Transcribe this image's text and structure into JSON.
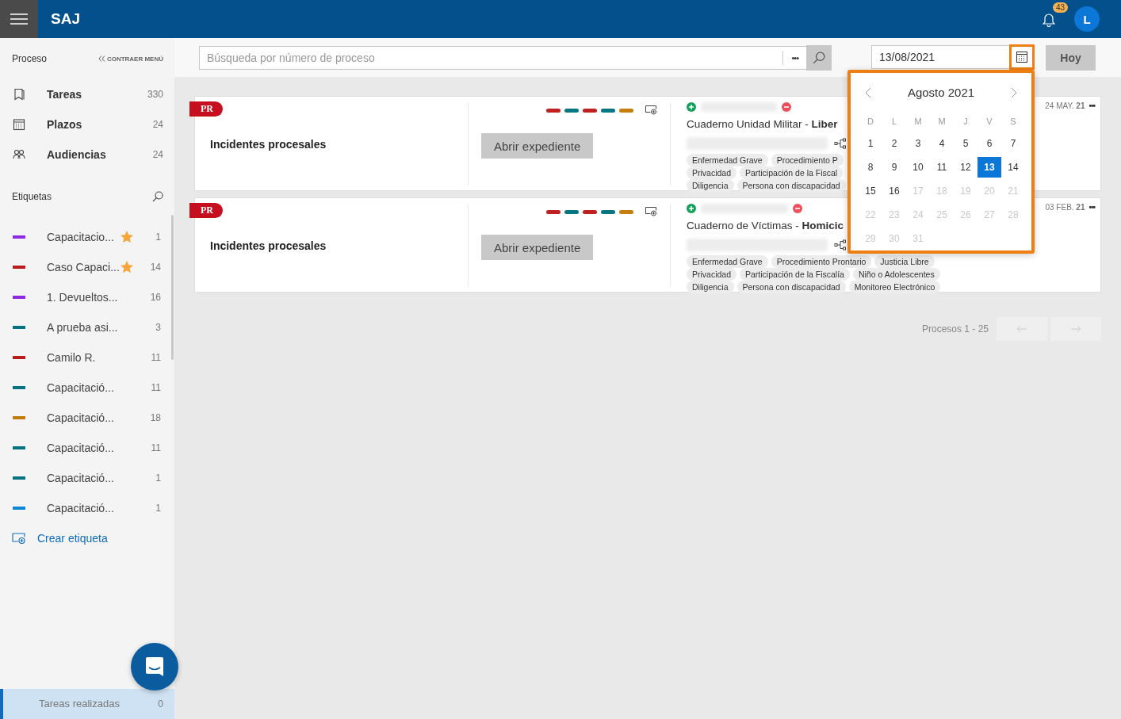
{
  "header": {
    "app_name": "SAJ",
    "notifications": "43",
    "avatar": "L"
  },
  "sidebar": {
    "section_title": "Proceso",
    "collapse": "CONTRAER MENÚ",
    "nav": [
      {
        "label": "Tareas",
        "count": "330"
      },
      {
        "label": "Plazos",
        "count": "24"
      },
      {
        "label": "Audiencias",
        "count": "24"
      }
    ],
    "tags_title": "Etiquetas",
    "tags": [
      {
        "label": "Capacitacio...",
        "count": "1",
        "color": "#8a2be2",
        "starred": true
      },
      {
        "label": "Caso Capaci...",
        "count": "14",
        "color": "#b91c1c",
        "starred": true
      },
      {
        "label": "1. Devueltos...",
        "count": "16",
        "color": "#8a2be2",
        "starred": false
      },
      {
        "label": "A prueba asi...",
        "count": "3",
        "color": "#05737f",
        "starred": false
      },
      {
        "label": "Camilo R.",
        "count": "11",
        "color": "#b91c1c",
        "starred": false
      },
      {
        "label": "Capacitació...",
        "count": "11",
        "color": "#05737f",
        "starred": false
      },
      {
        "label": "Capacitació...",
        "count": "18",
        "color": "#c07a0a",
        "starred": false
      },
      {
        "label": "Capacitació...",
        "count": "11",
        "color": "#05737f",
        "starred": false
      },
      {
        "label": "Capacitació...",
        "count": "1",
        "color": "#05737f",
        "starred": false
      },
      {
        "label": "Capacitació...",
        "count": "1",
        "color": "#0f87d8",
        "starred": false
      }
    ],
    "create_tag": "Crear etiqueta",
    "footer": {
      "label": "Tareas realizadas",
      "count": "0",
      "selected": true
    }
  },
  "toolbar": {
    "search_placeholder": "Búsqueda por número de proceso",
    "more": "•••",
    "date_value": "13/08/2021",
    "today_button": "Hoy"
  },
  "calendar": {
    "month": "Agosto 2021",
    "weekdays": [
      "D",
      "L",
      "M",
      "M",
      "J",
      "V",
      "S"
    ],
    "days": [
      {
        "label": "1",
        "selected": false,
        "disabled": false
      },
      {
        "label": "2",
        "selected": false,
        "disabled": false
      },
      {
        "label": "3",
        "selected": false,
        "disabled": false
      },
      {
        "label": "4",
        "selected": false,
        "disabled": false
      },
      {
        "label": "5",
        "selected": false,
        "disabled": false
      },
      {
        "label": "6",
        "selected": false,
        "disabled": false
      },
      {
        "label": "7",
        "selected": false,
        "disabled": false
      },
      {
        "label": "8",
        "selected": false,
        "disabled": false
      },
      {
        "label": "9",
        "selected": false,
        "disabled": false
      },
      {
        "label": "10",
        "selected": false,
        "disabled": false
      },
      {
        "label": "11",
        "selected": false,
        "disabled": false
      },
      {
        "label": "12",
        "selected": false,
        "disabled": false
      },
      {
        "label": "13",
        "selected": true,
        "disabled": false
      },
      {
        "label": "14",
        "selected": false,
        "disabled": false
      },
      {
        "label": "15",
        "selected": false,
        "disabled": false
      },
      {
        "label": "16",
        "selected": false,
        "disabled": false
      },
      {
        "label": "17",
        "selected": false,
        "disabled": true
      },
      {
        "label": "18",
        "selected": false,
        "disabled": true
      },
      {
        "label": "19",
        "selected": false,
        "disabled": true
      },
      {
        "label": "20",
        "selected": false,
        "disabled": true
      },
      {
        "label": "21",
        "selected": false,
        "disabled": true
      },
      {
        "label": "22",
        "selected": false,
        "disabled": true
      },
      {
        "label": "23",
        "selected": false,
        "disabled": true
      },
      {
        "label": "24",
        "selected": false,
        "disabled": true
      },
      {
        "label": "25",
        "selected": false,
        "disabled": true
      },
      {
        "label": "26",
        "selected": false,
        "disabled": true
      },
      {
        "label": "27",
        "selected": false,
        "disabled": true
      },
      {
        "label": "28",
        "selected": false,
        "disabled": true
      },
      {
        "label": "29",
        "selected": false,
        "disabled": true
      },
      {
        "label": "30",
        "selected": false,
        "disabled": true
      },
      {
        "label": "31",
        "selected": false,
        "disabled": true
      }
    ]
  },
  "cards": [
    {
      "badge": "PR",
      "title": "Incidentes procesales",
      "labels": [
        {
          "color": "#c0201f"
        },
        {
          "color": "#087585"
        },
        {
          "color": "#c0201f"
        },
        {
          "color": "#087585"
        },
        {
          "color": "#c47f0c"
        }
      ],
      "button": "Abrir expediente",
      "case_title": "Cuaderno Unidad Militar - **Liber**",
      "date": "24 MAY. **21**",
      "more": "•••",
      "tag_rows": [
        [
          "Enfermedad Grave",
          "Procedimiento P"
        ],
        [
          "Privacidad",
          "Participación de la Fiscal"
        ],
        [
          "Diligencia",
          "Persona con discapacidad"
        ]
      ]
    },
    {
      "badge": "PR",
      "title": "Incidentes procesales",
      "labels": [
        {
          "color": "#c0201f"
        },
        {
          "color": "#087585"
        },
        {
          "color": "#c0201f"
        },
        {
          "color": "#087585"
        },
        {
          "color": "#c47f0c"
        }
      ],
      "button": "Abrir expediente",
      "case_title": "Cuaderno de Víctimas - **Homicic**",
      "date": "03 FEB. **21**",
      "more": "•••",
      "tag_rows": [
        [
          "Enfermedad Grave",
          "Procedimiento Prontario",
          "Justicia Libre"
        ],
        [
          "Privacidad",
          "Participación de la Fiscalía",
          "Niño o Adolescentes"
        ],
        [
          "Diligencia",
          "Persona con discapacidad",
          "Monitoreo Electrónico"
        ]
      ]
    }
  ],
  "pagination": {
    "label": "Procesos 1 - 25",
    "previous": {
      "disabled": true
    },
    "next": {
      "disabled": true
    }
  }
}
